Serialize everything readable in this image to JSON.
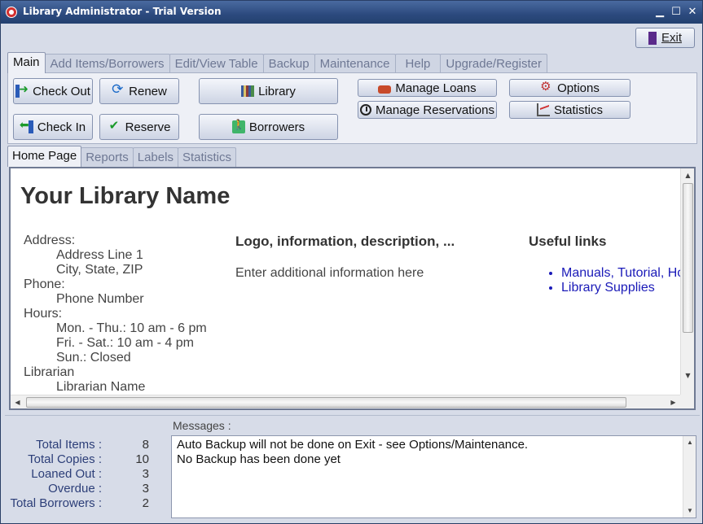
{
  "window": {
    "title": "Library Administrator - Trial Version"
  },
  "exit_label": "Exit",
  "top_tabs": [
    "Main",
    "Add Items/Borrowers",
    "Edit/View Table",
    "Backup",
    "Maintenance",
    "Help",
    "Upgrade/Register"
  ],
  "toolbar": {
    "check_out": "Check Out",
    "renew": "Renew",
    "check_in": "Check In",
    "reserve": "Reserve",
    "library": "Library",
    "borrowers": "Borrowers",
    "manage_loans": "Manage Loans",
    "manage_reservations": "Manage Reservations",
    "options": "Options",
    "statistics": "Statistics"
  },
  "sub_tabs": [
    "Home Page",
    "Reports",
    "Labels",
    "Statistics"
  ],
  "home": {
    "library_name": "Your Library Name",
    "address_label": "Address:",
    "address_line1": "Address Line 1",
    "address_line2": "City, State, ZIP",
    "phone_label": "Phone:",
    "phone": "Phone Number",
    "hours_label": "Hours:",
    "hours1": "Mon. - Thu.: 10 am - 6 pm",
    "hours2": "Fri. - Sat.: 10 am - 4 pm",
    "hours3": "Sun.: Closed",
    "librarian_label": "Librarian",
    "librarian_name": "Librarian Name",
    "logo_heading": "Logo, information, description, ...",
    "info_text": "Enter additional information here",
    "links_heading": "Useful links",
    "links": [
      "Manuals, Tutorial, How to start",
      "Library Supplies"
    ]
  },
  "messages_label": "Messages :",
  "stats": [
    {
      "label": "Total Items :",
      "value": "8"
    },
    {
      "label": "Total Copies :",
      "value": "10"
    },
    {
      "label": "Loaned Out :",
      "value": "3"
    },
    {
      "label": "Overdue :",
      "value": "3"
    },
    {
      "label": "Total Borrowers :",
      "value": "2"
    }
  ],
  "messages": [
    "Auto Backup will not be done on Exit - see Options/Maintenance.",
    "No Backup has been done yet"
  ]
}
